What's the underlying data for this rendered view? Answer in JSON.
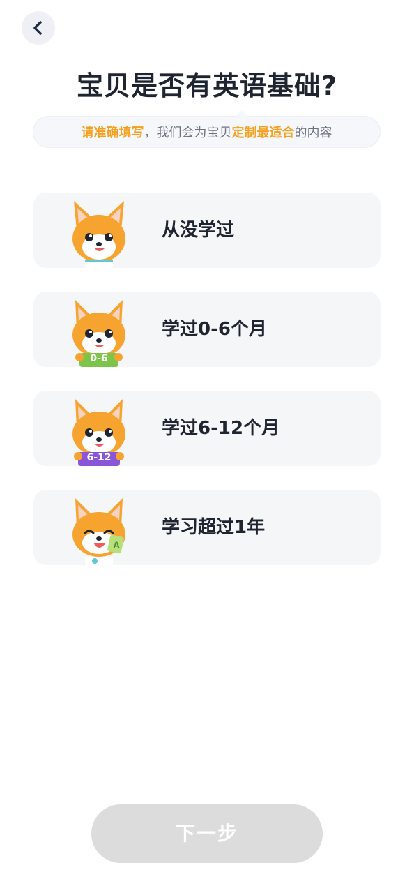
{
  "header": {
    "back_icon": "chevron-left-icon",
    "title": "宝贝是否有英语基础?"
  },
  "subtitle": {
    "part1": "请准确填写",
    "part2": "，我们会为宝贝",
    "part3": "定制最适合",
    "part4": "的内容",
    "highlight_color": "#f5a11e"
  },
  "options": [
    {
      "label": "从没学过",
      "badge": ""
    },
    {
      "label": "学过0-6个月",
      "badge": "0-6"
    },
    {
      "label": "学过6-12个月",
      "badge": "6-12"
    },
    {
      "label": "学习超过1年",
      "badge": ""
    }
  ],
  "footer": {
    "next_label": "下一步"
  },
  "colors": {
    "mascot_orange": "#f7a330",
    "badge_green": "#7cc44a",
    "badge_purple": "#8a55d6",
    "button_disabled": "#dcdcdc"
  }
}
